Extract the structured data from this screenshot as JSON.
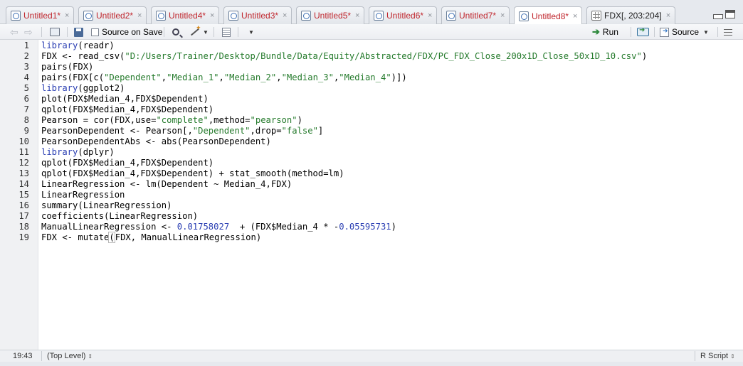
{
  "tabs": [
    {
      "label": "Untitled1*",
      "modified": true
    },
    {
      "label": "Untitled2*",
      "modified": true
    },
    {
      "label": "Untitled4*",
      "modified": true
    },
    {
      "label": "Untitled3*",
      "modified": true
    },
    {
      "label": "Untitled5*",
      "modified": true
    },
    {
      "label": "Untitled6*",
      "modified": true
    },
    {
      "label": "Untitled7*",
      "modified": true
    },
    {
      "label": "Untitled8*",
      "modified": true,
      "active": true
    },
    {
      "label": "FDX[, 203:204]",
      "modified": false,
      "icon": "data-grid-icon"
    }
  ],
  "close_glyph": "×",
  "toolbar": {
    "back_glyph": "⇦",
    "forward_glyph": "⇨",
    "source_on_save_label": "Source on Save",
    "source_on_save_checked": false,
    "run_label": "Run",
    "source_label": "Source",
    "caret": "▼"
  },
  "editor": {
    "line_numbers": [
      "1",
      "2",
      "3",
      "4",
      "5",
      "6",
      "7",
      "8",
      "9",
      "10",
      "11",
      "12",
      "13",
      "14",
      "15",
      "16",
      "17",
      "18",
      "19"
    ],
    "lines": [
      "library(readr)",
      "FDX <- read_csv(\"D:/Users/Trainer/Desktop/Bundle/Data/Equity/Abstracted/FDX/PC_FDX_Close_200x1D_Close_50x1D_10.csv\")",
      "pairs(FDX)",
      "pairs(FDX[c(\"Dependent\",\"Median_1\",\"Median_2\",\"Median_3\",\"Median_4\")])",
      "library(ggplot2)",
      "plot(FDX$Median_4,FDX$Dependent)",
      "qplot(FDX$Median_4,FDX$Dependent)",
      "Pearson = cor(FDX,use=\"complete\",method=\"pearson\")",
      "PearsonDependent <- Pearson[,\"Dependent\",drop=\"false\"]",
      "PearsonDependentAbs <- abs(PearsonDependent)",
      "library(dplyr)",
      "qplot(FDX$Median_4,FDX$Dependent)",
      "qplot(FDX$Median_4,FDX$Dependent) + stat_smooth(method=lm)",
      "LinearRegression <- lm(Dependent ~ Median_4,FDX)",
      "LinearRegression",
      "summary(LinearRegression)",
      "coefficients(LinearRegression)",
      "ManualLinearRegression <- 0.01758027  + (FDX$Median_4 * -0.05595731)",
      "FDX <- mutate(FDX, ManualLinearRegression)"
    ]
  },
  "status": {
    "cursor_position": "19:43",
    "scope": "(Top Level)",
    "updown_glyph": "⇕",
    "language": "R Script"
  },
  "colors": {
    "keyword": "#2b3fb3",
    "string": "#247a2b",
    "number": "#2b3fb3",
    "modified_tab_text": "#c0262d",
    "run_arrow": "#2f8a3e"
  }
}
